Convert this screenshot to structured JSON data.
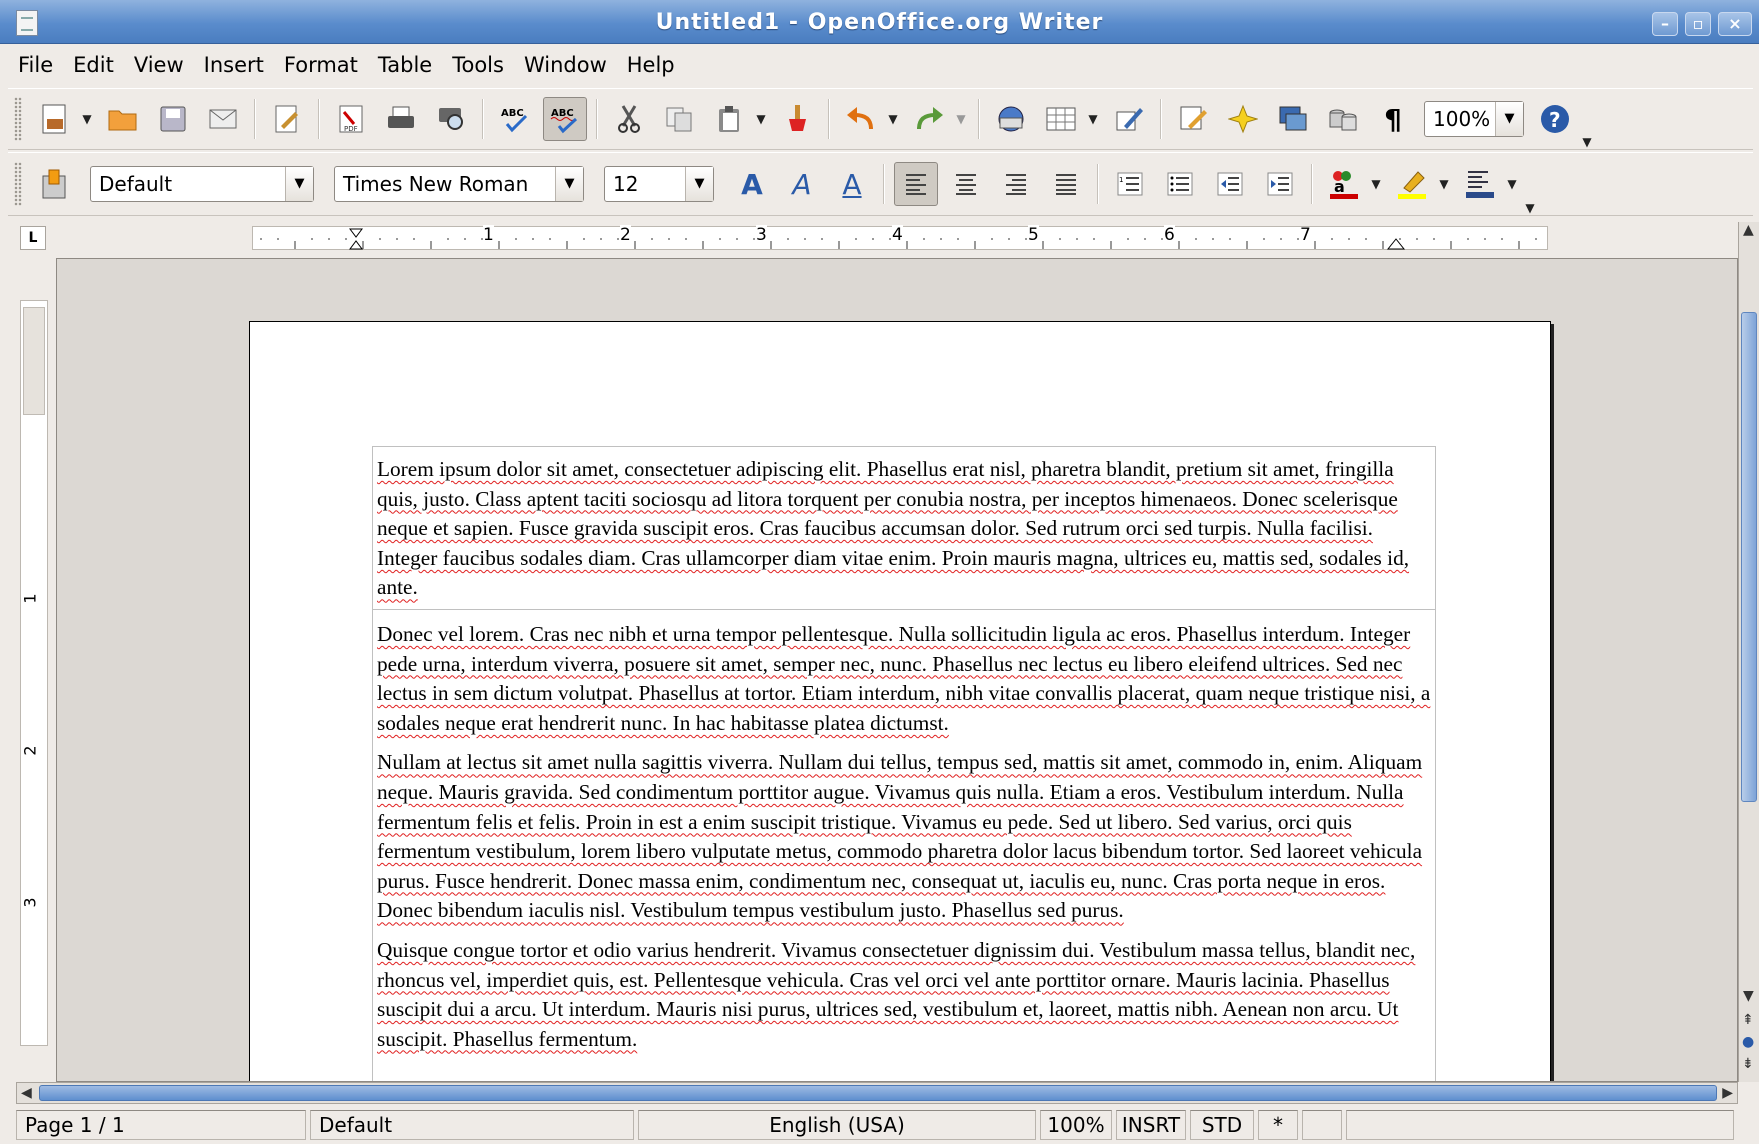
{
  "window": {
    "title": "Untitled1 - OpenOffice.org Writer"
  },
  "menu": [
    "File",
    "Edit",
    "View",
    "Insert",
    "Format",
    "Table",
    "Tools",
    "Window",
    "Help"
  ],
  "toolbar_standard": {
    "zoom": "100%"
  },
  "toolbar_formatting": {
    "style": "Default",
    "font": "Times New Roman",
    "size": "12"
  },
  "ruler": {
    "marks": [
      "1",
      "2",
      "3",
      "4",
      "5",
      "6",
      "7"
    ],
    "vmarks": [
      "1",
      "2",
      "3"
    ]
  },
  "document": {
    "paragraphs": [
      "Lorem ipsum dolor sit amet, consectetuer adipiscing elit. Phasellus erat nisl, pharetra blandit, pretium sit amet, fringilla quis, justo. Class aptent taciti sociosqu ad litora torquent per conubia nostra, per inceptos himenaeos. Donec scelerisque neque et sapien. Fusce gravida suscipit eros. Cras faucibus accumsan dolor. Sed rutrum orci sed turpis. Nulla facilisi. Integer faucibus sodales diam. Cras ullamcorper diam vitae enim. Proin mauris magna, ultrices eu, mattis sed, sodales id, ante.",
      "Donec vel lorem. Cras nec nibh et urna tempor pellentesque. Nulla sollicitudin ligula ac eros. Phasellus interdum. Integer pede urna, interdum viverra, posuere sit amet, semper nec, nunc. Phasellus nec lectus eu libero eleifend ultrices. Sed nec lectus in sem dictum volutpat. Phasellus at tortor. Etiam interdum, nibh vitae convallis placerat, quam neque tristique nisi, a sodales neque erat hendrerit nunc. In hac habitasse platea dictumst.",
      "Nullam at lectus sit amet nulla sagittis viverra. Nullam dui tellus, tempus sed, mattis sit amet, commodo in, enim. Aliquam neque. Mauris gravida. Sed condimentum porttitor augue. Vivamus quis nulla. Etiam a eros. Vestibulum interdum. Nulla fermentum felis et felis. Proin in est a enim suscipit tristique. Vivamus eu pede. Sed ut libero. Sed varius, orci quis fermentum vestibulum, lorem libero vulputate metus, commodo pharetra dolor lacus bibendum tortor. Sed laoreet vehicula purus. Fusce hendrerit. Donec massa enim, condimentum nec, consequat ut, iaculis eu, nunc. Cras porta neque in eros. Donec bibendum iaculis nisl. Vestibulum tempus vestibulum justo. Phasellus sed purus.",
      "Quisque congue tortor et odio varius hendrerit. Vivamus consectetuer dignissim dui. Vestibulum massa tellus, blandit nec, rhoncus vel, imperdiet quis, est. Pellentesque vehicula. Cras vel orci vel ante porttitor ornare. Mauris lacinia. Phasellus suscipit dui a arcu. Ut interdum. Mauris nisi purus, ultrices sed, vestibulum et, laoreet, mattis nibh. Aenean non arcu. Ut suscipit. Phasellus fermentum."
    ]
  },
  "status": {
    "page": "Page 1 / 1",
    "style": "Default",
    "language": "English (USA)",
    "zoom": "100%",
    "insert_mode": "INSRT",
    "selection_mode": "STD",
    "modified": "*"
  }
}
